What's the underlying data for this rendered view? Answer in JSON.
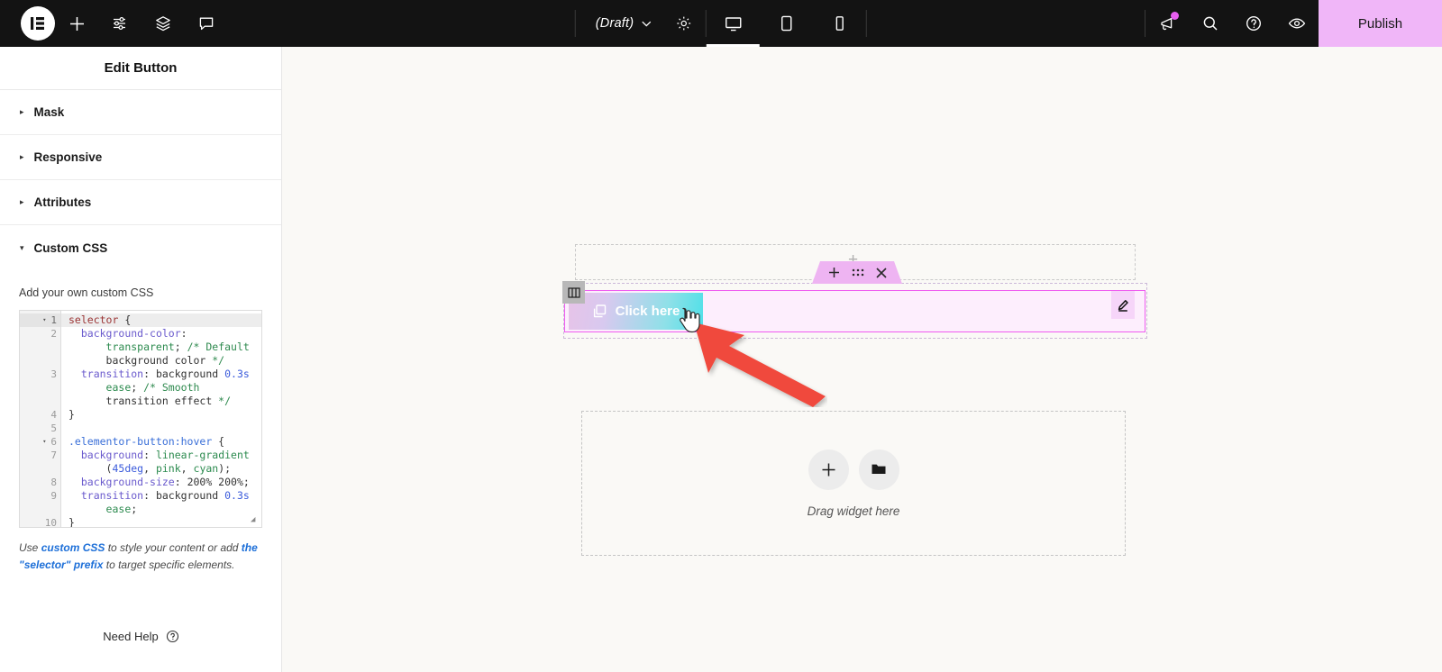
{
  "topbar": {
    "logo_alt": "elementor-logo",
    "left_icons": [
      {
        "name": "add-element-icon",
        "glyph": "plus"
      },
      {
        "name": "settings-sliders-icon",
        "glyph": "sliders"
      },
      {
        "name": "layers-navigator-icon",
        "glyph": "layers"
      },
      {
        "name": "comments-icon",
        "glyph": "comment"
      }
    ],
    "status_label": "(Draft)",
    "status_chevron": "chevron-down",
    "settings_icon": "gear-icon",
    "devices": [
      {
        "name": "desktop",
        "active": true
      },
      {
        "name": "tablet",
        "active": false
      },
      {
        "name": "mobile",
        "active": false
      }
    ],
    "right_icons": [
      {
        "name": "whats-new-megaphone-icon",
        "has_badge": true
      },
      {
        "name": "search-icon",
        "has_badge": false
      },
      {
        "name": "help-icon",
        "has_badge": false
      },
      {
        "name": "preview-eye-icon",
        "has_badge": false
      }
    ],
    "publish_label": "Publish",
    "publish_color": "#f0b6f8",
    "bar_color": "#131313"
  },
  "panel": {
    "title": "Edit Button",
    "sections": [
      {
        "label": "Mask",
        "expanded": false,
        "arrow": "▸"
      },
      {
        "label": "Responsive",
        "expanded": false,
        "arrow": "▸"
      },
      {
        "label": "Attributes",
        "expanded": false,
        "arrow": "▸"
      },
      {
        "label": "Custom CSS",
        "expanded": true,
        "arrow": "▾"
      }
    ],
    "custom_css": {
      "description": "Add your own custom CSS",
      "editor": {
        "lines": [
          {
            "num": "1",
            "fold": "▾",
            "highlight": true
          },
          {
            "num": "2",
            "fold": "",
            "highlight": false
          },
          {
            "num": "",
            "fold": "",
            "highlight": false
          },
          {
            "num": "",
            "fold": "",
            "highlight": false
          },
          {
            "num": "3",
            "fold": "",
            "highlight": false
          },
          {
            "num": "",
            "fold": "",
            "highlight": false
          },
          {
            "num": "",
            "fold": "",
            "highlight": false
          },
          {
            "num": "4",
            "fold": "",
            "highlight": false
          },
          {
            "num": "5",
            "fold": "",
            "highlight": false
          },
          {
            "num": "6",
            "fold": "▾",
            "highlight": false
          },
          {
            "num": "7",
            "fold": "",
            "highlight": false
          },
          {
            "num": "",
            "fold": "",
            "highlight": false
          },
          {
            "num": "8",
            "fold": "",
            "highlight": false
          },
          {
            "num": "9",
            "fold": "",
            "highlight": false
          },
          {
            "num": "",
            "fold": "",
            "highlight": false
          },
          {
            "num": "10",
            "fold": "",
            "highlight": false
          }
        ],
        "code_text": "selector {\n  background-color:\n      transparent; /* Default\n      background color */\n  transition: background 0.3s\n      ease; /* Smooth\n      transition effect */\n}\n\n.elementor-button:hover {\n  background: linear-gradient\n      (45deg, pink, cyan);\n  background-size: 200% 200%;\n  transition: background 0.3s\n      ease;\n}"
      },
      "help_prefix": "Use ",
      "help_link1": "custom CSS",
      "help_middle": " to style your content or add ",
      "help_link2": "the \"selector\" prefix",
      "help_suffix": " to target specific elements."
    },
    "need_help_label": "Need Help",
    "need_help_icon": "question-circle-icon",
    "collapse_icon": "chevron-left-icon"
  },
  "canvas": {
    "background": "#faf9f6",
    "widget_toolbar": [
      {
        "name": "add-widget-icon",
        "glyph": "+"
      },
      {
        "name": "drag-handle-icon",
        "glyph": "dots"
      },
      {
        "name": "delete-widget-icon",
        "glyph": "×"
      }
    ],
    "column_handle_icon": "column-layout-icon",
    "button_widget": {
      "label": "Click here",
      "icon": "duplicate-icon",
      "gradient_from": "#e7c3e8",
      "gradient_to": "#4fe0e8",
      "border_color": "#ef5cf0"
    },
    "edit_tab_icon": "pencil-edit-icon",
    "drop_zone": {
      "label": "Drag widget here",
      "buttons": [
        {
          "name": "add-new-widget-button",
          "icon": "plus-icon"
        },
        {
          "name": "open-template-library-button",
          "icon": "folder-icon"
        }
      ]
    },
    "annotation": {
      "arrow_color": "#f0483c",
      "cursor": "pointer-hand"
    }
  }
}
